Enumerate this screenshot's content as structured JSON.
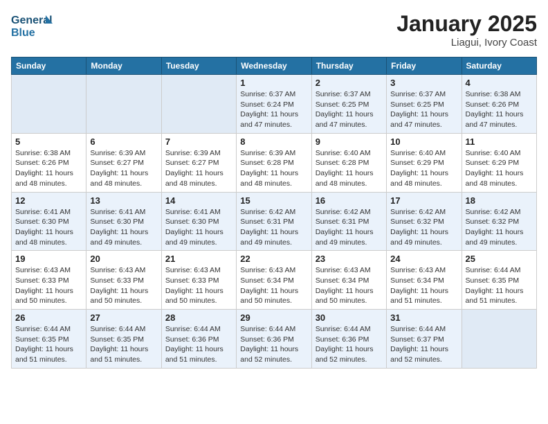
{
  "header": {
    "logo_line1": "General",
    "logo_line2": "Blue",
    "month": "January 2025",
    "location": "Liagui, Ivory Coast"
  },
  "weekdays": [
    "Sunday",
    "Monday",
    "Tuesday",
    "Wednesday",
    "Thursday",
    "Friday",
    "Saturday"
  ],
  "weeks": [
    [
      {
        "day": "",
        "info": ""
      },
      {
        "day": "",
        "info": ""
      },
      {
        "day": "",
        "info": ""
      },
      {
        "day": "1",
        "info": "Sunrise: 6:37 AM\nSunset: 6:24 PM\nDaylight: 11 hours and 47 minutes."
      },
      {
        "day": "2",
        "info": "Sunrise: 6:37 AM\nSunset: 6:25 PM\nDaylight: 11 hours and 47 minutes."
      },
      {
        "day": "3",
        "info": "Sunrise: 6:37 AM\nSunset: 6:25 PM\nDaylight: 11 hours and 47 minutes."
      },
      {
        "day": "4",
        "info": "Sunrise: 6:38 AM\nSunset: 6:26 PM\nDaylight: 11 hours and 47 minutes."
      }
    ],
    [
      {
        "day": "5",
        "info": "Sunrise: 6:38 AM\nSunset: 6:26 PM\nDaylight: 11 hours and 48 minutes."
      },
      {
        "day": "6",
        "info": "Sunrise: 6:39 AM\nSunset: 6:27 PM\nDaylight: 11 hours and 48 minutes."
      },
      {
        "day": "7",
        "info": "Sunrise: 6:39 AM\nSunset: 6:27 PM\nDaylight: 11 hours and 48 minutes."
      },
      {
        "day": "8",
        "info": "Sunrise: 6:39 AM\nSunset: 6:28 PM\nDaylight: 11 hours and 48 minutes."
      },
      {
        "day": "9",
        "info": "Sunrise: 6:40 AM\nSunset: 6:28 PM\nDaylight: 11 hours and 48 minutes."
      },
      {
        "day": "10",
        "info": "Sunrise: 6:40 AM\nSunset: 6:29 PM\nDaylight: 11 hours and 48 minutes."
      },
      {
        "day": "11",
        "info": "Sunrise: 6:40 AM\nSunset: 6:29 PM\nDaylight: 11 hours and 48 minutes."
      }
    ],
    [
      {
        "day": "12",
        "info": "Sunrise: 6:41 AM\nSunset: 6:30 PM\nDaylight: 11 hours and 48 minutes."
      },
      {
        "day": "13",
        "info": "Sunrise: 6:41 AM\nSunset: 6:30 PM\nDaylight: 11 hours and 49 minutes."
      },
      {
        "day": "14",
        "info": "Sunrise: 6:41 AM\nSunset: 6:30 PM\nDaylight: 11 hours and 49 minutes."
      },
      {
        "day": "15",
        "info": "Sunrise: 6:42 AM\nSunset: 6:31 PM\nDaylight: 11 hours and 49 minutes."
      },
      {
        "day": "16",
        "info": "Sunrise: 6:42 AM\nSunset: 6:31 PM\nDaylight: 11 hours and 49 minutes."
      },
      {
        "day": "17",
        "info": "Sunrise: 6:42 AM\nSunset: 6:32 PM\nDaylight: 11 hours and 49 minutes."
      },
      {
        "day": "18",
        "info": "Sunrise: 6:42 AM\nSunset: 6:32 PM\nDaylight: 11 hours and 49 minutes."
      }
    ],
    [
      {
        "day": "19",
        "info": "Sunrise: 6:43 AM\nSunset: 6:33 PM\nDaylight: 11 hours and 50 minutes."
      },
      {
        "day": "20",
        "info": "Sunrise: 6:43 AM\nSunset: 6:33 PM\nDaylight: 11 hours and 50 minutes."
      },
      {
        "day": "21",
        "info": "Sunrise: 6:43 AM\nSunset: 6:33 PM\nDaylight: 11 hours and 50 minutes."
      },
      {
        "day": "22",
        "info": "Sunrise: 6:43 AM\nSunset: 6:34 PM\nDaylight: 11 hours and 50 minutes."
      },
      {
        "day": "23",
        "info": "Sunrise: 6:43 AM\nSunset: 6:34 PM\nDaylight: 11 hours and 50 minutes."
      },
      {
        "day": "24",
        "info": "Sunrise: 6:43 AM\nSunset: 6:34 PM\nDaylight: 11 hours and 51 minutes."
      },
      {
        "day": "25",
        "info": "Sunrise: 6:44 AM\nSunset: 6:35 PM\nDaylight: 11 hours and 51 minutes."
      }
    ],
    [
      {
        "day": "26",
        "info": "Sunrise: 6:44 AM\nSunset: 6:35 PM\nDaylight: 11 hours and 51 minutes."
      },
      {
        "day": "27",
        "info": "Sunrise: 6:44 AM\nSunset: 6:35 PM\nDaylight: 11 hours and 51 minutes."
      },
      {
        "day": "28",
        "info": "Sunrise: 6:44 AM\nSunset: 6:36 PM\nDaylight: 11 hours and 51 minutes."
      },
      {
        "day": "29",
        "info": "Sunrise: 6:44 AM\nSunset: 6:36 PM\nDaylight: 11 hours and 52 minutes."
      },
      {
        "day": "30",
        "info": "Sunrise: 6:44 AM\nSunset: 6:36 PM\nDaylight: 11 hours and 52 minutes."
      },
      {
        "day": "31",
        "info": "Sunrise: 6:44 AM\nSunset: 6:37 PM\nDaylight: 11 hours and 52 minutes."
      },
      {
        "day": "",
        "info": ""
      }
    ]
  ]
}
